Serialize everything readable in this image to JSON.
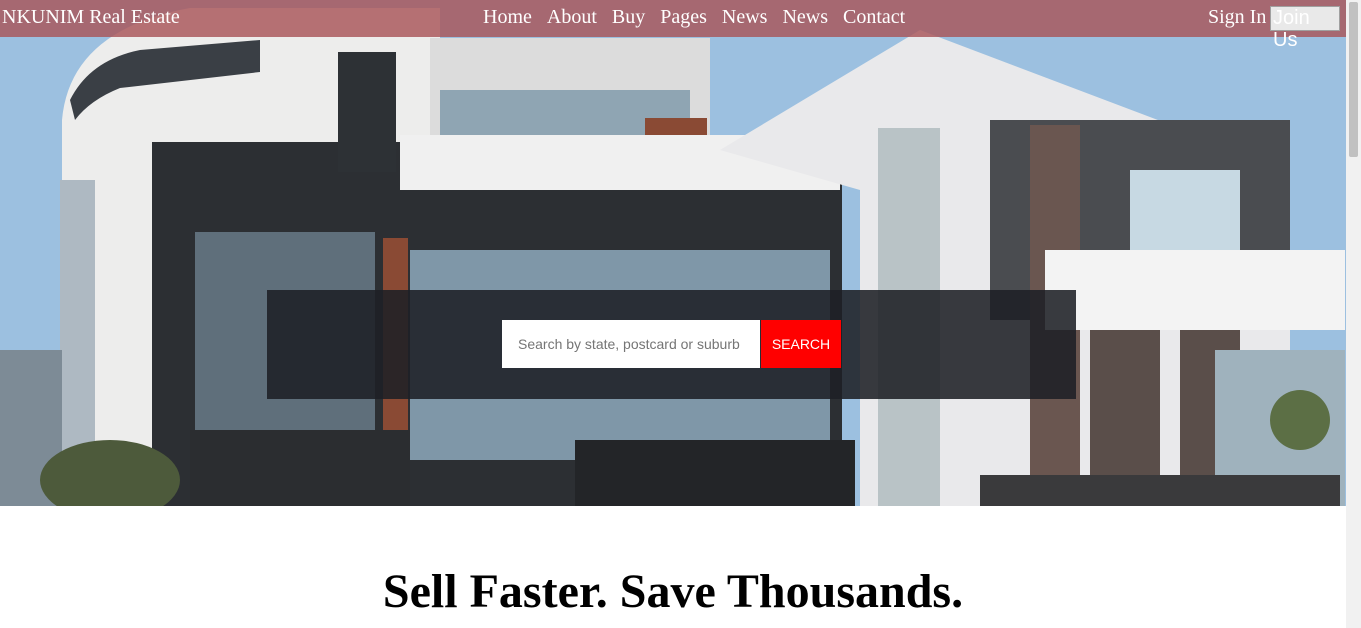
{
  "navbar": {
    "brand": "NKUNIM Real Estate",
    "links": [
      "Home",
      "About",
      "Buy",
      "Pages",
      "News",
      "News",
      "Contact"
    ],
    "sign_in": "Sign In",
    "join_us": "Join Us"
  },
  "hero": {
    "search": {
      "placeholder": "Search by state, postcard or suburb",
      "value": "",
      "button_label": "SEARCH"
    }
  },
  "main": {
    "headline": "Sell Faster. Save Thousands."
  },
  "colors": {
    "navbar_bg": "#a85458",
    "search_button": "#ff0000",
    "search_panel": "#1e2026"
  }
}
